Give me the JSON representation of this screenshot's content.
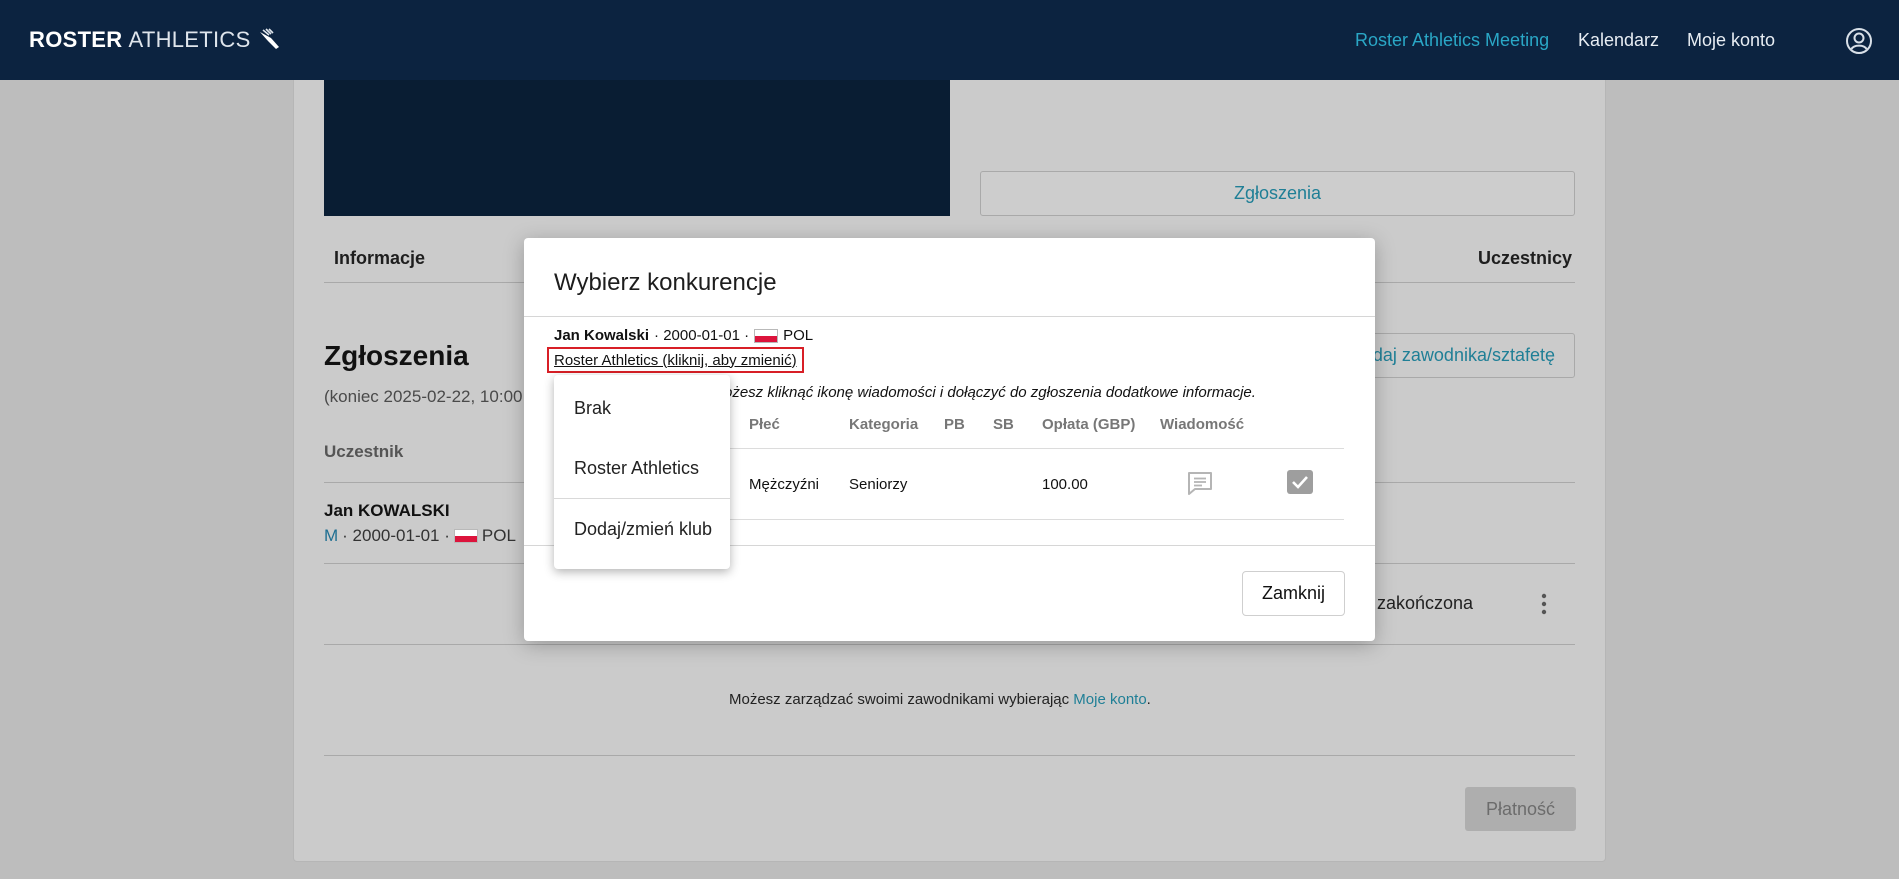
{
  "header": {
    "logo_bold": "ROSTER",
    "logo_thin": "ATHLETICS",
    "nav": [
      "Roster Athletics Meeting",
      "Kalendarz",
      "Moje konto"
    ]
  },
  "page": {
    "entries_button": "Zgłoszenia",
    "tabs": {
      "info": "Informacje",
      "participants": "Uczestnicy"
    },
    "section_title": "Zgłoszenia",
    "deadline": "(koniec 2025-02-22, 10:00",
    "add_athlete_button": "daj zawodnika/sztafetę",
    "column_participant": "Uczestnik",
    "athlete": {
      "name": "Jan KOWALSKI",
      "sex": "M",
      "dob": "· 2000-01-01 ·",
      "country": "POL"
    },
    "status": "zakończona",
    "manage_text": "Możesz zarządzać swoimi zawodnikami wybierając ",
    "manage_link": "Moje konto",
    "manage_end": ".",
    "pay_button": "Płatność"
  },
  "modal": {
    "title": "Wybierz konkurencje",
    "athlete_name": "Jan Kowalski",
    "athlete_dob": "· 2000-01-01 ·",
    "athlete_country": "POL",
    "club_link": "Roster Athletics (kliknij, aby zmienić)",
    "hint": "ożesz kliknąć ikonę wiadomości i dołączyć do zgłoszenia dodatkowe informacje.",
    "columns": [
      "Płeć",
      "Kategoria",
      "PB",
      "SB",
      "Opłata (GBP)",
      "Wiadomość"
    ],
    "row": {
      "sex": "Mężczyźni",
      "category": "Seniorzy",
      "fee": "100.00",
      "selected": true
    },
    "close_button": "Zamknij"
  },
  "dropdown": {
    "items": [
      "Brak",
      "Roster Athletics",
      "Dodaj/zmień klub"
    ]
  }
}
